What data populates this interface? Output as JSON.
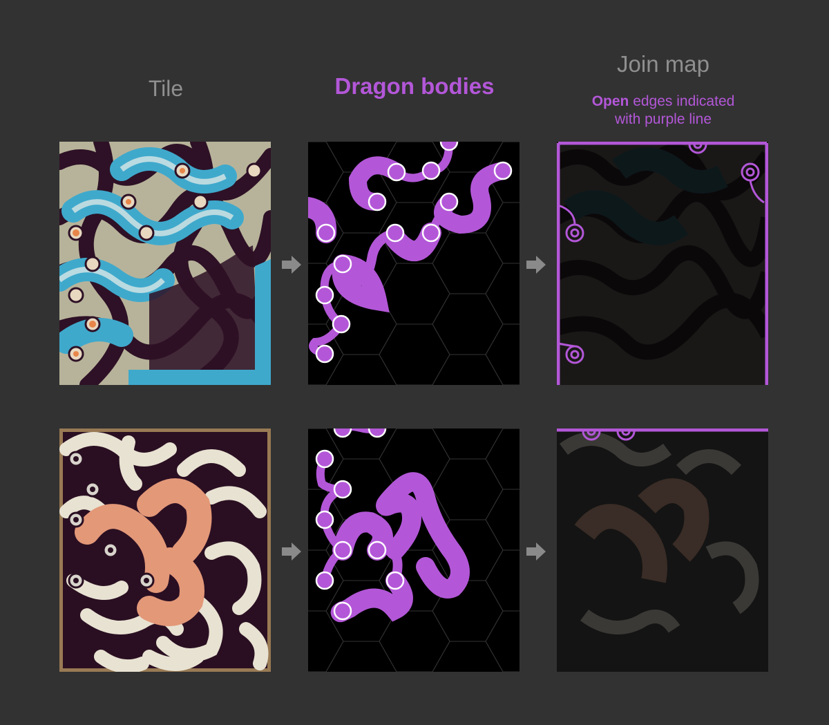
{
  "headers": {
    "tile": "Tile",
    "dragon_bodies": "Dragon bodies",
    "join_map": "Join map",
    "note_bold": "Open",
    "note_line1_rest": " edges indicated",
    "note_line2": "with purple line"
  },
  "colors": {
    "background": "#323232",
    "accent_purple": "#b357d8",
    "header_gray": "#8f8f8f",
    "arrow_gray": "#8a8a8a",
    "tile1_blue": "#3fa9cc",
    "tile1_plum": "#2e1126",
    "tile1_sand": "#b7b39a",
    "tile2_cream": "#e8e2d2",
    "tile2_peach": "#e39878",
    "tile2_dark": "#2a0f22"
  },
  "icons": {
    "arrow": "right-arrow-icon"
  }
}
